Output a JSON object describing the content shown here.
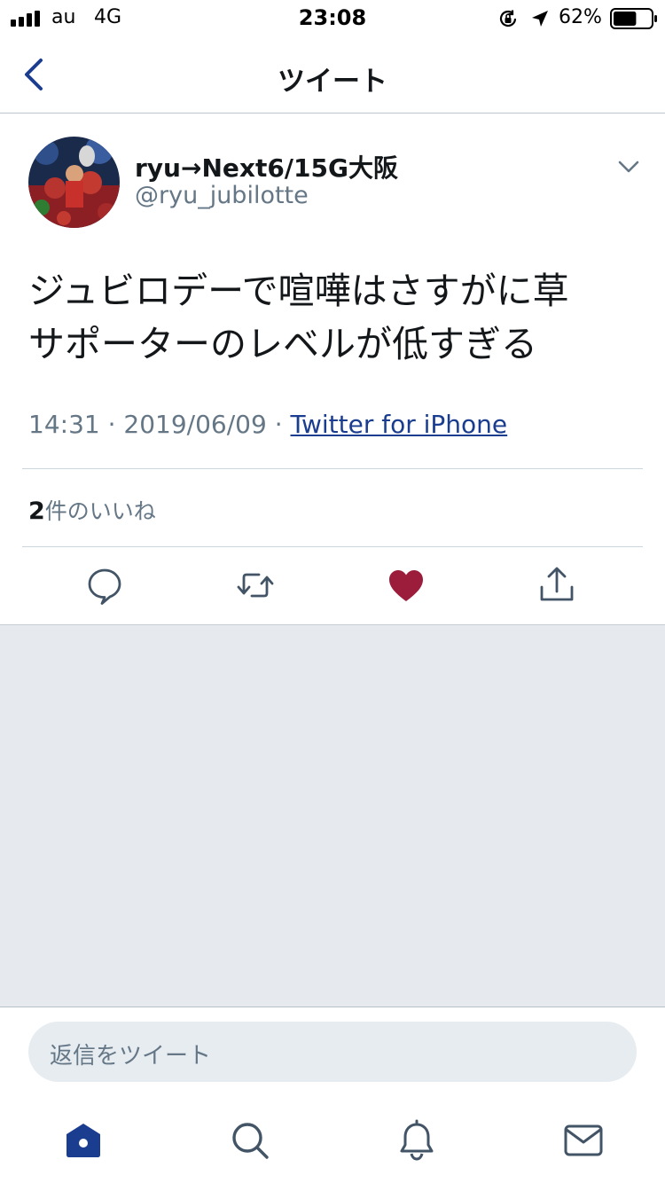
{
  "status_bar": {
    "carrier": "au",
    "network": "4G",
    "time": "23:08",
    "battery_percent": "62%",
    "battery_level": 0.62,
    "icons": [
      "signal-icon",
      "orientation-lock-icon",
      "location-arrow-icon",
      "battery-icon"
    ]
  },
  "nav": {
    "title": "ツイート",
    "back_icon": "chevron-left-icon"
  },
  "tweet": {
    "display_name": "ryu→Next6/15G大阪",
    "handle": "@ryu_jubilotte",
    "text_line1": "ジュビロデーで喧嘩はさすがに草",
    "text_line2": "サポーターのレベルが低すぎる",
    "time": "14:31",
    "date": "2019/06/09",
    "separator": " · ",
    "source": "Twitter for iPhone",
    "like_count": "2",
    "like_label": "件のいいね",
    "liked": true
  },
  "actions": {
    "icons": [
      "reply-icon",
      "retweet-icon",
      "heart-icon",
      "share-icon"
    ]
  },
  "reply": {
    "placeholder": "返信をツイート"
  },
  "tab_bar": {
    "icons": [
      "home-icon",
      "search-icon",
      "notifications-icon",
      "messages-icon"
    ]
  },
  "colors": {
    "accent": "#1b3d8f",
    "like": "#9b1d3b",
    "secondary_text": "#657786",
    "gray_area": "#e6e9ed"
  }
}
